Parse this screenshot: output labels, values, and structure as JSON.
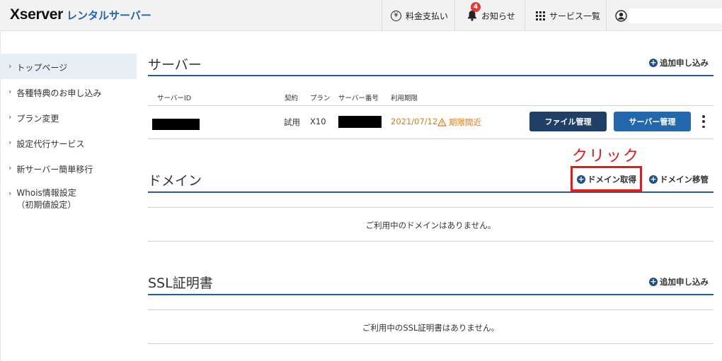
{
  "header": {
    "logo_main": "Xserver",
    "logo_sub": "レンタルサーバー",
    "payment_label": "料金支払い",
    "payment_icon": "yen-icon",
    "notice_label": "お知らせ",
    "notice_badge": "4",
    "services_label": "サービス一覧",
    "account_icon": "user-icon"
  },
  "sidebar": {
    "items": [
      {
        "label": "トップページ"
      },
      {
        "label": "各種特典のお申し込み"
      },
      {
        "label": "プラン変更"
      },
      {
        "label": "設定代行サービス"
      },
      {
        "label": "新サーバー簡単移行"
      },
      {
        "label": "Whois情報設定",
        "sublabel": "（初期値設定）"
      }
    ]
  },
  "server": {
    "title": "サーバー",
    "add_label": "追加申し込み",
    "columns": [
      "サーバーID",
      "契約",
      "プラン",
      "サーバー番号",
      "利用期限"
    ],
    "row": {
      "contract": "試用",
      "plan": "X10",
      "expiry": "2021/07/12",
      "warning": "期限間近"
    },
    "file_button": "ファイル管理",
    "server_button": "サーバー管理"
  },
  "domain": {
    "title": "ドメイン",
    "acquire_label": "ドメイン取得",
    "transfer_label": "ドメイン移管",
    "empty": "ご利用中のドメインはありません。",
    "annotation": "クリック"
  },
  "ssl": {
    "title": "SSL証明書",
    "add_label": "追加申し込み",
    "empty": "ご利用中のSSL証明書はありません。"
  },
  "colors": {
    "accent": "#2a5c93",
    "warning": "#e07b1c",
    "annotation": "#e21b1b"
  }
}
